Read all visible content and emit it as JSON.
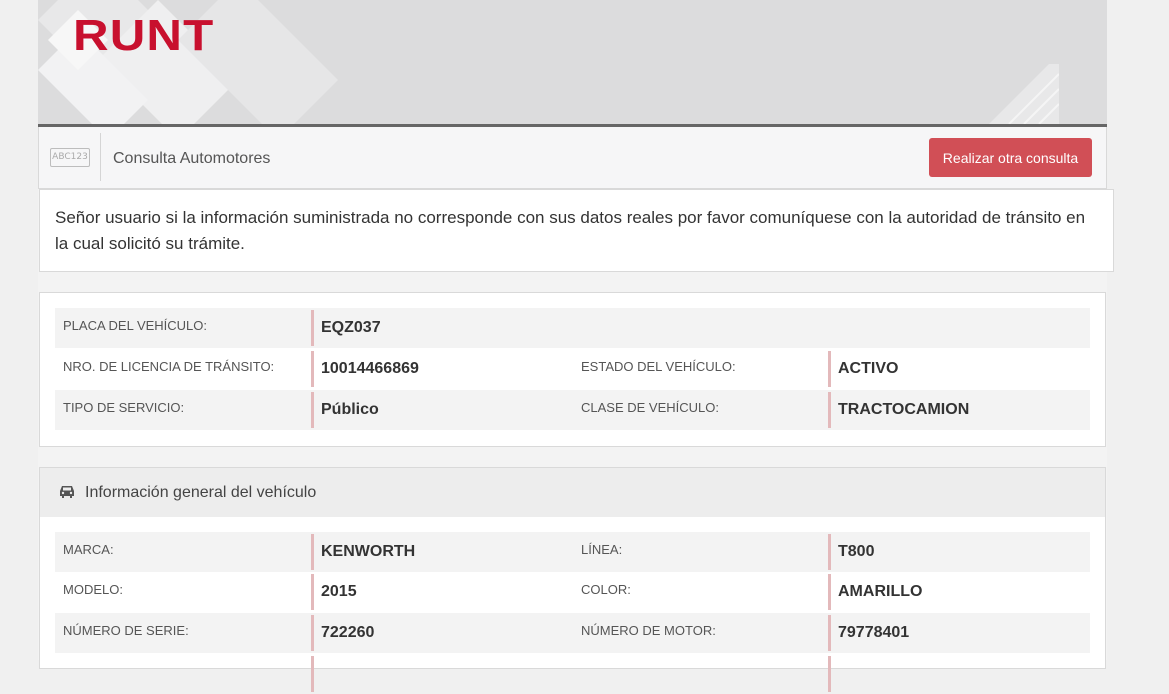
{
  "brand": {
    "logo_text": "RUNT",
    "color": "#c8102e"
  },
  "toolbar": {
    "icon_text": "ABC123",
    "title": "Consulta Automotores",
    "button_label": "Realizar otra consulta",
    "button_color": "#d14f56"
  },
  "notice": {
    "text": "Señor usuario si la información suministrada no corresponde con sus datos reales por favor comuníquese con la autoridad de tránsito en la cual solicitó su trámite."
  },
  "summary": {
    "placa_label": "PLACA DEL VEHÍCULO:",
    "placa_value": "EQZ037",
    "licencia_label": "NRO. DE LICENCIA DE TRÁNSITO:",
    "licencia_value": "10014466869",
    "estado_label": "ESTADO DEL VEHÍCULO:",
    "estado_value": "ACTIVO",
    "servicio_label": "TIPO DE SERVICIO:",
    "servicio_value": "Público",
    "clase_label": "CLASE DE VEHÍCULO:",
    "clase_value": "TRACTOCAMION"
  },
  "general": {
    "title": "Información general del vehículo",
    "icon": "car-icon",
    "marca_label": "MARCA:",
    "marca_value": "KENWORTH",
    "linea_label": "LÍNEA:",
    "linea_value": "T800",
    "modelo_label": "MODELO:",
    "modelo_value": "2015",
    "color_label": "COLOR:",
    "color_value": "AMARILLO",
    "serie_label": "NÚMERO DE SERIE:",
    "serie_value": "722260",
    "motor_label": "NÚMERO DE MOTOR:",
    "motor_value": "79778401"
  }
}
